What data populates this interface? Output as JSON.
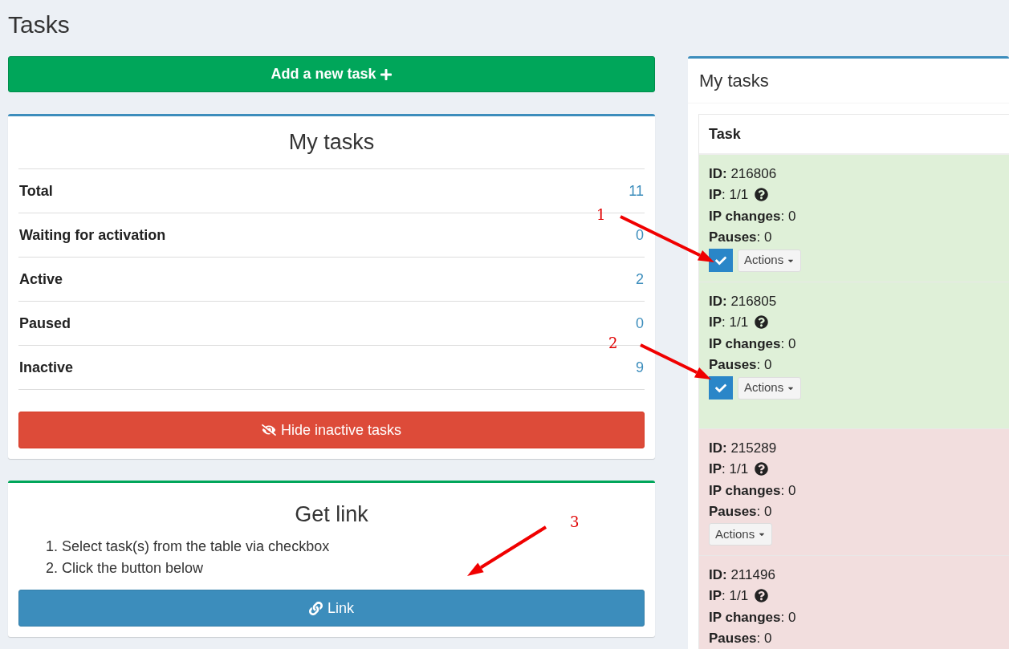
{
  "page_title": "Tasks",
  "add_button": "Add a new task",
  "stats": {
    "title": "My tasks",
    "rows": [
      {
        "label": "Total",
        "value": "11"
      },
      {
        "label": "Waiting for activation",
        "value": "0"
      },
      {
        "label": "Active",
        "value": "2"
      },
      {
        "label": "Paused",
        "value": "0"
      },
      {
        "label": "Inactive",
        "value": "9"
      }
    ],
    "hide_button": "Hide inactive tasks"
  },
  "get_link": {
    "title": "Get link",
    "steps": [
      "1. Select task(s) from the table via checkbox",
      "2. Click the button below"
    ],
    "button": "Link"
  },
  "tasks_panel": {
    "title": "My tasks",
    "column": "Task",
    "rows": [
      {
        "color": "#dff0d8",
        "checked": true,
        "id_label": "ID:",
        "id": "216806",
        "ip_label": "IP",
        "ip": ": 1/1",
        "changes_label": "IP changes",
        "changes": ": 0",
        "pauses_label": "Pauses",
        "pauses": ": 0",
        "actions": "Actions"
      },
      {
        "color": "#dff0d8",
        "checked": true,
        "id_label": "ID:",
        "id": "216805",
        "ip_label": "IP",
        "ip": ": 1/1",
        "changes_label": "IP changes",
        "changes": ": 0",
        "pauses_label": "Pauses",
        "pauses": ": 0",
        "actions": "Actions"
      },
      {
        "color": "#f2dede",
        "checked": false,
        "id_label": "ID:",
        "id": "215289",
        "ip_label": "IP",
        "ip": ": 1/1",
        "changes_label": "IP changes",
        "changes": ": 0",
        "pauses_label": "Pauses",
        "pauses": ": 0",
        "actions": "Actions"
      },
      {
        "color": "#f2dede",
        "id_label": "ID:",
        "id": "211496",
        "ip_label": "IP",
        "ip": ": 1/1",
        "changes_label": "IP changes",
        "changes": ": 0",
        "pauses_label": "Pauses",
        "pauses": ": 0"
      }
    ]
  },
  "annotations": [
    "1",
    "2",
    "3"
  ]
}
